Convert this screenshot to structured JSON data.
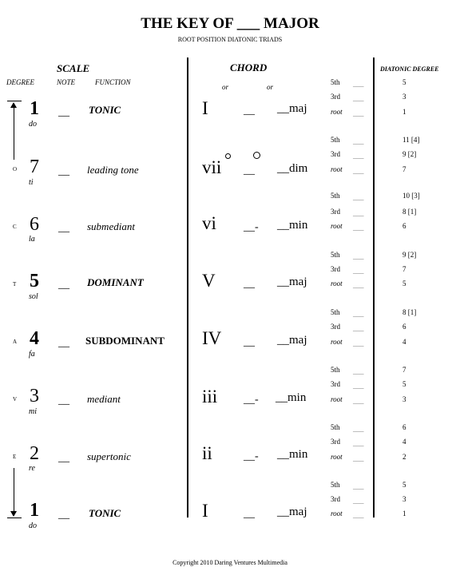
{
  "title": "THE KEY OF ___ MAJOR",
  "subtitle": "ROOT POSITION DIATONIC TRIADS",
  "headers": {
    "scale": "SCALE",
    "chord": "CHORD",
    "diatonic_degree": "DIATONIC DEGREE",
    "degree": "DEGREE",
    "note": "NOTE",
    "function": "FUNCTION",
    "or1": "or",
    "or2": "or"
  },
  "side_letters": [
    "O",
    "C",
    "T",
    "A",
    "V",
    "E"
  ],
  "blank": "__",
  "blank_dash": "__-",
  "tone_blank": "___",
  "rows": [
    {
      "degree": "1",
      "solfege": "do",
      "function": "TONIC",
      "roman": "I",
      "quality": "__maj",
      "tones": [
        "5th",
        "3rd",
        "root"
      ],
      "diatonic": [
        "5",
        "3",
        "1"
      ]
    },
    {
      "degree": "7",
      "solfege": "ti",
      "function": "leading tone",
      "roman": "vii",
      "quality": "__dim",
      "tones": [
        "5th",
        "3rd",
        "root"
      ],
      "diatonic": [
        "11 [4]",
        "9 [2]",
        "7"
      ]
    },
    {
      "degree": "6",
      "solfege": "la",
      "function": "submediant",
      "roman": "vi",
      "quality": "__min",
      "tones": [
        "5th",
        "3rd",
        "root"
      ],
      "diatonic": [
        "10 [3]",
        "8 [1]",
        "6"
      ]
    },
    {
      "degree": "5",
      "solfege": "sol",
      "function": "DOMINANT",
      "roman": "V",
      "quality": "__maj",
      "tones": [
        "5th",
        "3rd",
        "root"
      ],
      "diatonic": [
        "9 [2]",
        "7",
        "5"
      ]
    },
    {
      "degree": "4",
      "solfege": "fa",
      "function": "SUBDOMINANT",
      "roman": "IV",
      "quality": "__maj",
      "tones": [
        "5th",
        "3rd",
        "root"
      ],
      "diatonic": [
        "8 [1]",
        "6",
        "4"
      ]
    },
    {
      "degree": "3",
      "solfege": "mi",
      "function": "mediant",
      "roman": "iii",
      "quality": "__min",
      "tones": [
        "5th",
        "3rd",
        "root"
      ],
      "diatonic": [
        "7",
        "5",
        "3"
      ]
    },
    {
      "degree": "2",
      "solfege": "re",
      "function": "supertonic",
      "roman": "ii",
      "quality": "__min",
      "tones": [
        "5th",
        "3rd",
        "root"
      ],
      "diatonic": [
        "6",
        "4",
        "2"
      ]
    },
    {
      "degree": "1",
      "solfege": "do",
      "function": "TONIC",
      "roman": "I",
      "quality": "__maj",
      "tones": [
        "5th",
        "3rd",
        "root"
      ],
      "diatonic": [
        "5",
        "3",
        "1"
      ]
    }
  ],
  "copyright": "Copyright 2010 Daring Ventures Multimedia"
}
